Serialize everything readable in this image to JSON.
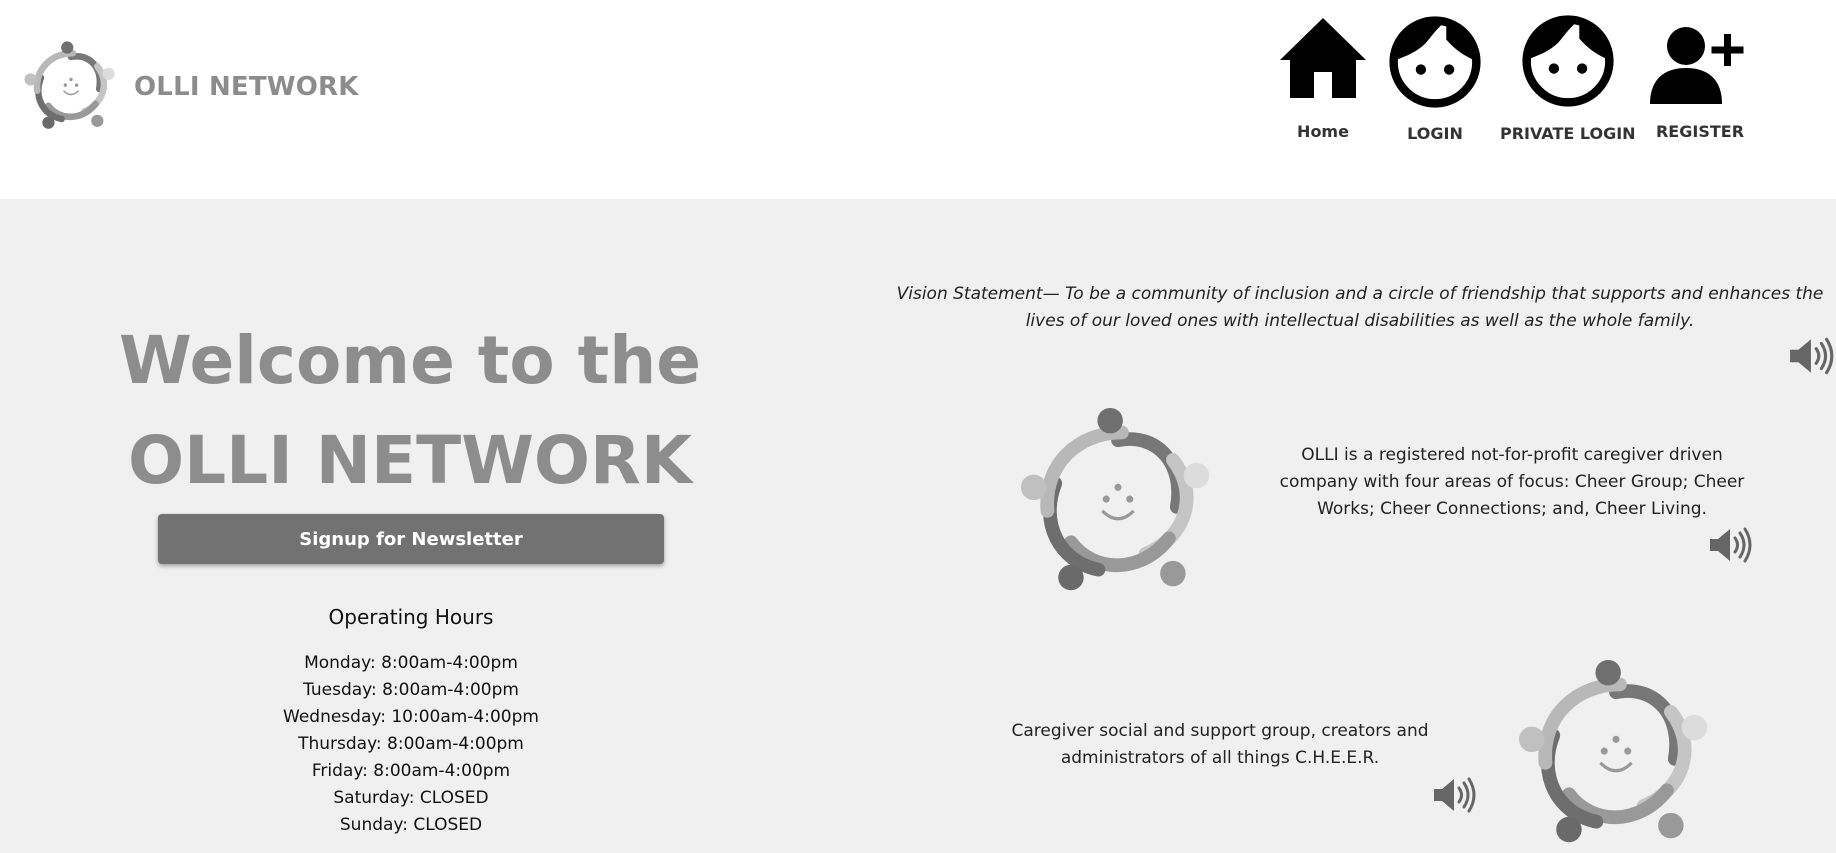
{
  "header": {
    "brand_name": "OLLI NETWORK",
    "nav": [
      {
        "label": "Home",
        "icon": "home-icon"
      },
      {
        "label": "LOGIN",
        "icon": "face-icon"
      },
      {
        "label": "PRIVATE LOGIN",
        "icon": "face-icon"
      },
      {
        "label": "REGISTER",
        "icon": "user-plus-icon"
      }
    ]
  },
  "main": {
    "welcome_title": "Welcome to the OLLI NETWORK",
    "newsletter_button": "Signup for Newsletter",
    "hours_title": "Operating Hours",
    "hours": [
      "Monday: 8:00am-4:00pm",
      "Tuesday: 8:00am-4:00pm",
      "Wednesday: 10:00am-4:00pm",
      "Thursday: 8:00am-4:00pm",
      "Friday: 8:00am-4:00pm",
      "Saturday: CLOSED",
      "Sunday: CLOSED"
    ],
    "vision_statement": "Vision Statement— To be a community of inclusion and a circle of friendship that supports and enhances the lives of our loved ones with intellectual disabilities as well as the whole family.",
    "about_text": "OLLI is a registered not-for-profit caregiver driven company with four areas of focus: Cheer Group; Cheer Works; Cheer Connections; and, Cheer Living.",
    "cheer_text": "Caregiver social and support group, creators and administrators of all things C.H.E.E.R."
  },
  "colors": {
    "header_bg": "#ffffff",
    "page_bg": "#f0f0f0",
    "title_gray": "#8d8d8d",
    "button_bg": "#727272",
    "button_text": "#ffffff"
  }
}
